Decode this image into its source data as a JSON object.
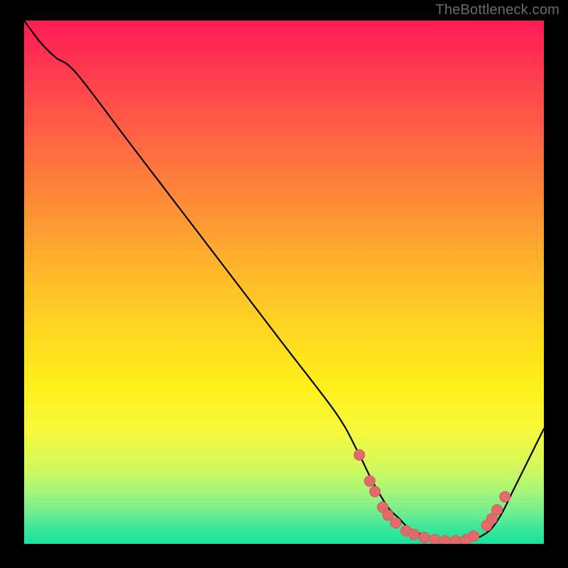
{
  "attribution": "TheBottleneck.com",
  "colors": {
    "curve_stroke": "#000000",
    "dot_fill": "#e26a6a",
    "dot_stroke": "#d35b5b"
  },
  "chart_data": {
    "type": "line",
    "title": "",
    "xlabel": "",
    "ylabel": "",
    "xlim": [
      0,
      100
    ],
    "ylim": [
      0,
      100
    ],
    "legend": false,
    "grid": false,
    "series": [
      {
        "name": "bottleneck-curve",
        "x": [
          0,
          3,
          6,
          10,
          20,
          30,
          40,
          50,
          60,
          64,
          67,
          70,
          72,
          74,
          76,
          78,
          80,
          82,
          84,
          86,
          88,
          90,
          92,
          94,
          96,
          98,
          100
        ],
        "y": [
          100,
          96,
          93,
          90,
          77,
          64,
          51,
          38,
          25,
          18,
          12,
          7,
          5,
          3,
          2,
          1.3,
          0.8,
          0.5,
          0.5,
          0.7,
          1.5,
          3,
          6,
          10,
          14,
          18,
          22
        ]
      }
    ],
    "markers": [
      {
        "x": 64.5,
        "y": 17.0
      },
      {
        "x": 66.5,
        "y": 12.0
      },
      {
        "x": 67.5,
        "y": 10.0
      },
      {
        "x": 69.0,
        "y": 7.0
      },
      {
        "x": 70.0,
        "y": 5.5
      },
      {
        "x": 71.5,
        "y": 4.0
      },
      {
        "x": 73.5,
        "y": 2.5
      },
      {
        "x": 75.0,
        "y": 1.8
      },
      {
        "x": 77.0,
        "y": 1.2
      },
      {
        "x": 79.0,
        "y": 0.8
      },
      {
        "x": 81.0,
        "y": 0.6
      },
      {
        "x": 83.0,
        "y": 0.6
      },
      {
        "x": 85.0,
        "y": 0.8
      },
      {
        "x": 86.5,
        "y": 1.5
      },
      {
        "x": 89.0,
        "y": 3.5
      },
      {
        "x": 90.0,
        "y": 4.8
      },
      {
        "x": 91.0,
        "y": 6.5
      },
      {
        "x": 92.5,
        "y": 9.0
      }
    ]
  }
}
